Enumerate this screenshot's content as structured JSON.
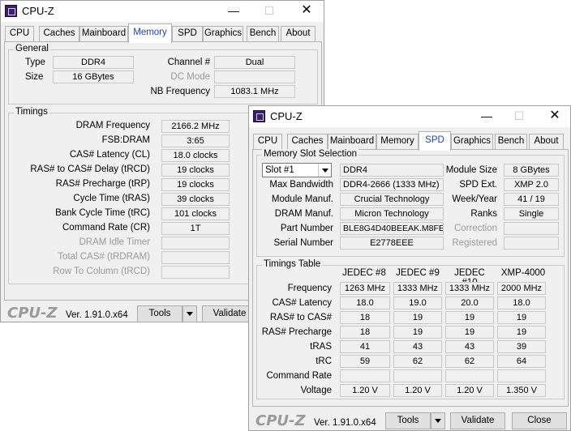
{
  "back": {
    "title": "CPU-Z",
    "tabs": [
      "CPU",
      "Caches",
      "Mainboard",
      "Memory",
      "SPD",
      "Graphics",
      "Bench",
      "About"
    ],
    "active_tab": "Memory",
    "general": {
      "title": "General",
      "type_label": "Type",
      "type_value": "DDR4",
      "size_label": "Size",
      "size_value": "16 GBytes",
      "channel_label": "Channel #",
      "channel_value": "Dual",
      "dc_mode_label": "DC Mode",
      "dc_mode_value": "",
      "nb_freq_label": "NB Frequency",
      "nb_freq_value": "1083.1 MHz"
    },
    "timings": {
      "title": "Timings",
      "rows": [
        {
          "label": "DRAM Frequency",
          "value": "2166.2 MHz"
        },
        {
          "label": "FSB:DRAM",
          "value": "3:65"
        },
        {
          "label": "CAS# Latency (CL)",
          "value": "18.0 clocks"
        },
        {
          "label": "RAS# to CAS# Delay (tRCD)",
          "value": "19 clocks"
        },
        {
          "label": "RAS# Precharge (tRP)",
          "value": "19 clocks"
        },
        {
          "label": "Cycle Time (tRAS)",
          "value": "39 clocks"
        },
        {
          "label": "Bank Cycle Time (tRC)",
          "value": "101 clocks"
        },
        {
          "label": "Command Rate (CR)",
          "value": "1T"
        },
        {
          "label": "DRAM Idle Timer",
          "value": ""
        },
        {
          "label": "Total CAS# (tRDRAM)",
          "value": ""
        },
        {
          "label": "Row To Column (tRCD)",
          "value": ""
        }
      ]
    },
    "footer": {
      "logo": "CPU-Z",
      "version": "Ver. 1.91.0.x64",
      "tools": "Tools",
      "validate": "Validate"
    }
  },
  "front": {
    "title": "CPU-Z",
    "tabs": [
      "CPU",
      "Caches",
      "Mainboard",
      "Memory",
      "SPD",
      "Graphics",
      "Bench",
      "About"
    ],
    "active_tab": "SPD",
    "slot": {
      "title": "Memory Slot Selection",
      "selected": "Slot #1",
      "type_value": "DDR4",
      "module_size_label": "Module Size",
      "module_size_value": "8 GBytes",
      "max_bw_label": "Max Bandwidth",
      "max_bw_value": "DDR4-2666 (1333 MHz)",
      "spd_ext_label": "SPD Ext.",
      "spd_ext_value": "XMP 2.0",
      "manuf_label": "Module Manuf.",
      "manuf_value": "Crucial Technology",
      "week_label": "Week/Year",
      "week_value": "41 / 19",
      "dram_manuf_label": "DRAM Manuf.",
      "dram_manuf_value": "Micron Technology",
      "ranks_label": "Ranks",
      "ranks_value": "Single",
      "part_label": "Part Number",
      "part_value": "BLE8G4D40BEEAK.M8FE1",
      "correction_label": "Correction",
      "correction_value": "",
      "serial_label": "Serial Number",
      "serial_value": "E2778EEE",
      "registered_label": "Registered",
      "registered_value": ""
    },
    "timings_table": {
      "title": "Timings Table",
      "columns": [
        "JEDEC #8",
        "JEDEC #9",
        "JEDEC #10",
        "XMP-4000"
      ],
      "rows": [
        {
          "label": "Frequency",
          "values": [
            "1263 MHz",
            "1333 MHz",
            "1333 MHz",
            "2000 MHz"
          ]
        },
        {
          "label": "CAS# Latency",
          "values": [
            "18.0",
            "19.0",
            "20.0",
            "18.0"
          ]
        },
        {
          "label": "RAS# to CAS#",
          "values": [
            "18",
            "19",
            "19",
            "19"
          ]
        },
        {
          "label": "RAS# Precharge",
          "values": [
            "18",
            "19",
            "19",
            "19"
          ]
        },
        {
          "label": "tRAS",
          "values": [
            "41",
            "43",
            "43",
            "39"
          ]
        },
        {
          "label": "tRC",
          "values": [
            "59",
            "62",
            "62",
            "64"
          ]
        },
        {
          "label": "Command Rate",
          "values": [
            "",
            "",
            "",
            ""
          ]
        },
        {
          "label": "Voltage",
          "values": [
            "1.20 V",
            "1.20 V",
            "1.20 V",
            "1.350 V"
          ]
        }
      ]
    },
    "footer": {
      "logo": "CPU-Z",
      "version": "Ver. 1.91.0.x64",
      "tools": "Tools",
      "validate": "Validate",
      "close": "Close"
    }
  }
}
